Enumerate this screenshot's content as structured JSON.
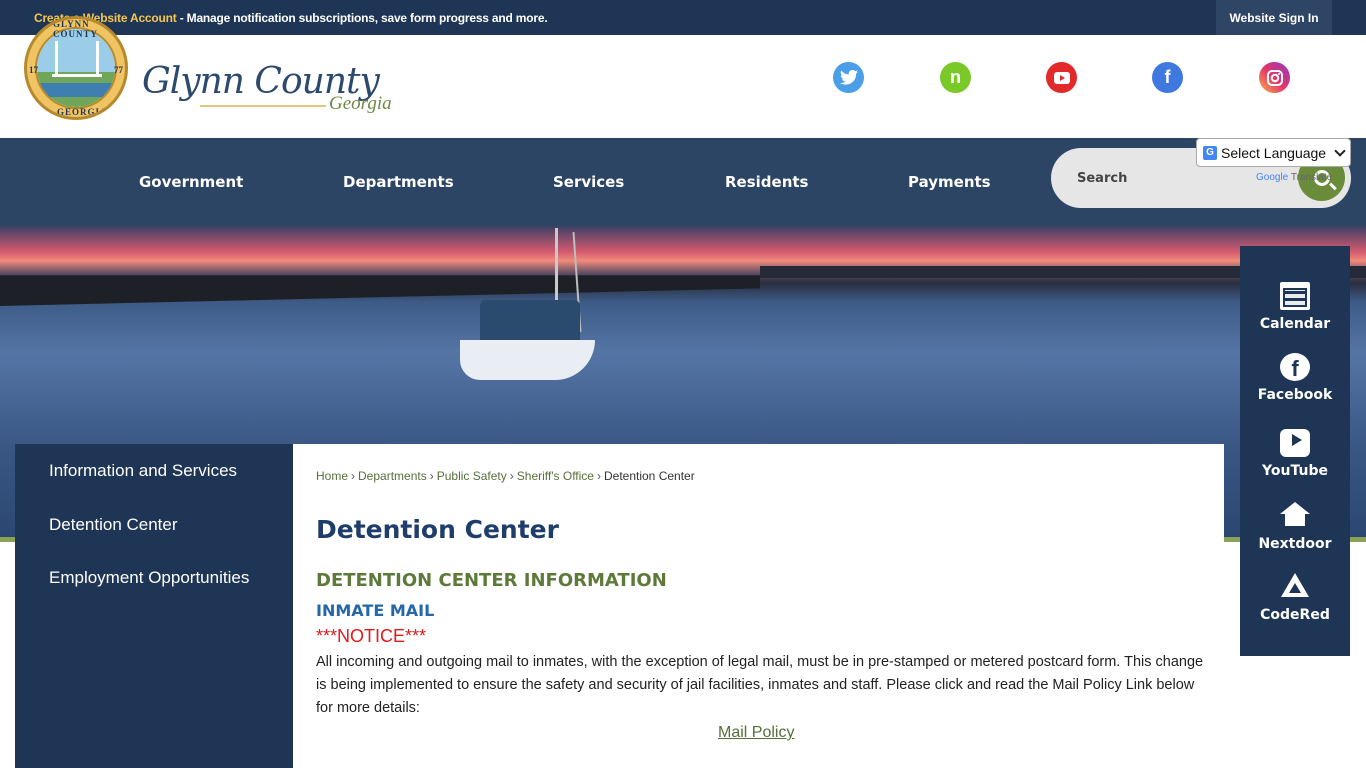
{
  "topbar": {
    "create_account": "Create a Website Account",
    "create_account_rest": " - Manage notification subscriptions, save form progress and more.",
    "sign_in": "Website Sign In"
  },
  "header": {
    "logo_name": "Glynn County",
    "logo_state": "Georgia",
    "seal_top": "GLYNN COUNTY",
    "seal_bottom": "GEORGIA",
    "seal_year_left": "17",
    "seal_year_right": "77",
    "social": [
      "twitter-icon",
      "nextdoor-icon",
      "youtube-icon",
      "facebook-icon",
      "instagram-icon"
    ]
  },
  "nav": {
    "items": [
      "Government",
      "Departments",
      "Services",
      "Residents",
      "Payments"
    ]
  },
  "search": {
    "placeholder": "Search"
  },
  "translate": {
    "select_label": "Select Language",
    "google": "Google",
    "translate": "Translate"
  },
  "sidebar": {
    "items": [
      "Information and Services",
      "Detention Center",
      "Employment Opportunities"
    ]
  },
  "breadcrumb": {
    "items": [
      "Home",
      "Departments",
      "Public Safety",
      "Sheriff's Office"
    ],
    "current": "Detention Center"
  },
  "content": {
    "title": "Detention Center",
    "section_heading": "DETENTION CENTER INFORMATION",
    "subheading": "INMATE MAIL",
    "notice": "***NOTICE***",
    "paragraph": "All incoming and outgoing mail to inmates, with the exception of legal mail, must be in pre-stamped or metered postcard form. This change is being implemented to ensure the safety and security of jail facilities, inmates and staff. Please click and read the Mail Policy Link below for more details:",
    "link": "Mail Policy"
  },
  "quick_links": {
    "items": [
      {
        "label": "Calendar",
        "icon": "calendar-icon"
      },
      {
        "label": "Facebook",
        "icon": "facebook-icon"
      },
      {
        "label": "YouTube",
        "icon": "youtube-icon"
      },
      {
        "label": "Nextdoor",
        "icon": "nextdoor-icon"
      },
      {
        "label": "CodeRed",
        "icon": "codered-icon"
      }
    ]
  },
  "colors": {
    "navy": "#1f3555",
    "nav_bg": "#2c4565",
    "accent_green": "#6a8c3a",
    "gold": "#f3c74f",
    "notice_red": "#e01b1b"
  }
}
